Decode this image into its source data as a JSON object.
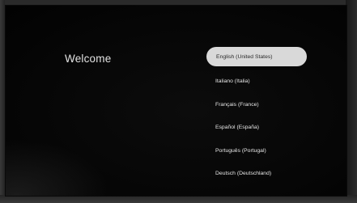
{
  "welcome": {
    "title": "Welcome"
  },
  "languages": {
    "selected_index": 0,
    "items": [
      {
        "label": "English (United States)"
      },
      {
        "label": "Italiano (Italia)"
      },
      {
        "label": "Français (France)"
      },
      {
        "label": "Español (España)"
      },
      {
        "label": "Português (Portugal)"
      },
      {
        "label": "Deutsch (Deutschland)"
      }
    ]
  }
}
